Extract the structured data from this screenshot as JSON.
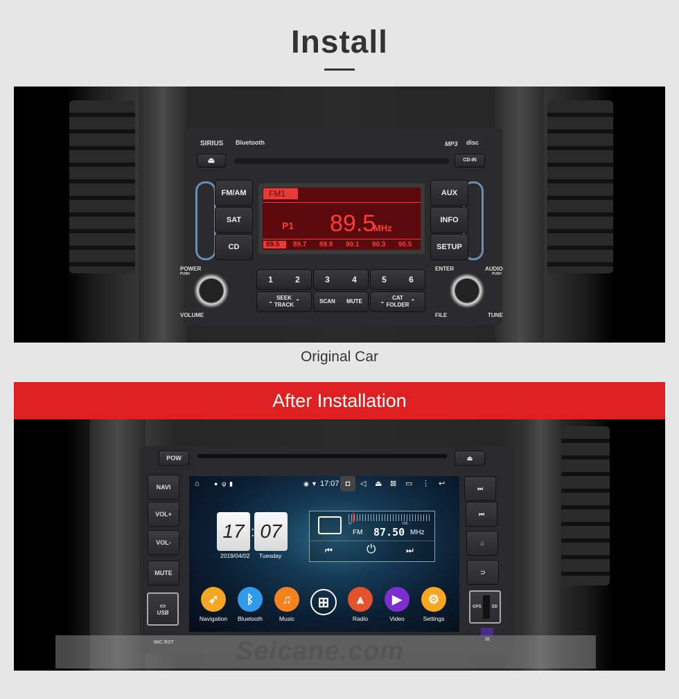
{
  "header": {
    "title": "Install"
  },
  "original": {
    "caption": "Original Car",
    "radio": {
      "brand_labels": [
        "SIRIUS",
        "Bluetooth",
        "MP3",
        "disc"
      ],
      "eject_icon": "eject-icon",
      "cd_in": "CD-IN",
      "left_buttons": [
        "FM/AM",
        "SAT",
        "CD"
      ],
      "right_buttons": [
        "AUX",
        "INFO",
        "SETUP"
      ],
      "display": {
        "band": "FM1",
        "preset": "P1",
        "frequency": "89.5",
        "unit": "MHz",
        "presets": [
          "89.5",
          "89.7",
          "89.9",
          "90.1",
          "90.3",
          "90.5"
        ]
      },
      "power_label": "POWER",
      "power_sub": "PUSH",
      "volume_label": "VOLUME",
      "enter_label": "ENTER",
      "audio_label": "AUDIO",
      "audio_sub": "PUSH",
      "file_label": "FILE",
      "tune_label": "TUNE",
      "number_buttons": [
        "1",
        "2",
        "3",
        "4",
        "5",
        "6"
      ],
      "seek_label": "SEEK\nTRACK",
      "scan_label": "SCAN",
      "mute_label": "MUTE",
      "cat_label": "CAT\nFOLDER"
    }
  },
  "after": {
    "banner": "After Installation",
    "unit": {
      "top_left": "POW",
      "left_buttons": [
        "NAVI",
        "VOL+",
        "VOL-",
        "MUTE"
      ],
      "usb_label": "USB",
      "mic_rst": "MIC RST",
      "right_buttons_icons": [
        "next-track-icon",
        "prev-track-icon",
        "home-icon",
        "back-icon"
      ],
      "gps_label": "GPS",
      "sd_label": "SD",
      "ir_label": "IR"
    },
    "screen": {
      "status_time": "17:07",
      "clock": {
        "hour": "17",
        "minute": "07",
        "date": "2019/04/02",
        "weekday": "Tuesday"
      },
      "radio": {
        "band": "FM",
        "frequency": "87.50",
        "unit": "MHz",
        "scale_min": "87",
        "scale_max": "108"
      },
      "apps": [
        {
          "label": "Navigation",
          "color": "#f5a623"
        },
        {
          "label": "Bluetooth",
          "color": "#2f9bea"
        },
        {
          "label": "Music",
          "color": "#f5821f"
        },
        {
          "label": "",
          "color": "transparent"
        },
        {
          "label": "Radio",
          "color": "#e2522b"
        },
        {
          "label": "Video",
          "color": "#7b2fd1"
        },
        {
          "label": "Settings",
          "color": "#f5a623"
        }
      ]
    },
    "watermark": "Seicane.com"
  }
}
